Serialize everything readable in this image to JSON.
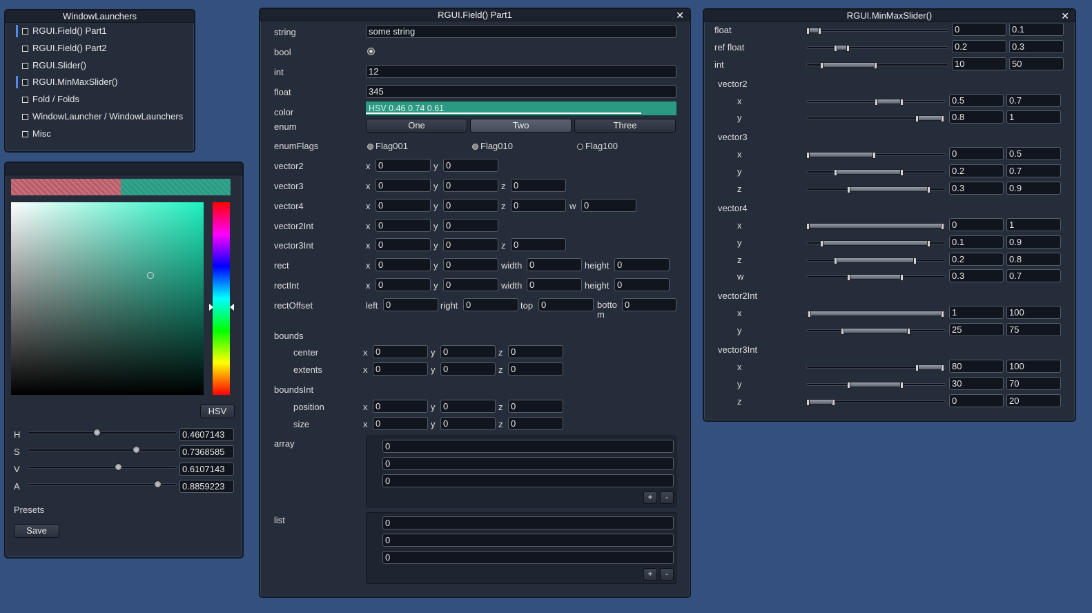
{
  "launchers": {
    "title": "WindowLaunchers",
    "items": [
      "RGUI.Field() Part1",
      "RGUI.Field() Part2",
      "RGUI.Slider()",
      "RGUI.MinMaxSlider()",
      "Fold / Folds",
      "WindowLauncher / WindowLaunchers",
      "Misc"
    ],
    "active_items": [
      0,
      3
    ]
  },
  "picker": {
    "mode_button": "HSV",
    "channels": [
      {
        "label": "H",
        "value": "0.4607143",
        "fraction": 0.4607143
      },
      {
        "label": "S",
        "value": "0.7368585",
        "fraction": 0.7368585
      },
      {
        "label": "V",
        "value": "0.6107143",
        "fraction": 0.6107143
      },
      {
        "label": "A",
        "value": "0.8859223",
        "fraction": 0.8859223
      }
    ],
    "presets_label": "Presets",
    "save_label": "Save",
    "old_color": "#b85b67",
    "new_color": "#2a9a83",
    "hue_color": "#1ef1c0"
  },
  "field": {
    "title": "RGUI.Field() Part1",
    "close": "✕",
    "string_label": "string",
    "string_value": "some string",
    "bool_label": "bool",
    "int_label": "int",
    "int_value": "12",
    "float_label": "float",
    "float_value": "345",
    "color_label": "color",
    "color_value": "HSV 0.46 0.74 0.61",
    "color_hex": "#2a9a83",
    "color_alpha": 0.8859,
    "enum_label": "enum",
    "enum_options": [
      "One",
      "Two",
      "Three"
    ],
    "enum_selected": 1,
    "enumflags_label": "enumFlags",
    "flags": [
      "Flag001",
      "Flag010",
      "Flag100"
    ],
    "axes": {
      "x": "x",
      "y": "y",
      "z": "z",
      "w": "w",
      "width": "width",
      "height": "height",
      "left": "left",
      "right": "right",
      "top": "top",
      "bottom": "botto\nm"
    },
    "vector2_label": "vector2",
    "vector3_label": "vector3",
    "vector4_label": "vector4",
    "vector2int_label": "vector2Int",
    "vector3int_label": "vector3Int",
    "rect_label": "rect",
    "rectint_label": "rectInt",
    "rectoffset_label": "rectOffset",
    "bounds_label": "bounds",
    "center_label": "center",
    "extents_label": "extents",
    "boundsint_label": "boundsInt",
    "position_label": "position",
    "size_label": "size",
    "zero": "0",
    "array_label": "array",
    "array_values": [
      "0",
      "0",
      "0"
    ],
    "list_label": "list",
    "list_values": [
      "0",
      "0",
      "0"
    ],
    "plus": "+",
    "minus": "-"
  },
  "minmax": {
    "title": "RGUI.MinMaxSlider()",
    "close": "✕",
    "rows": [
      {
        "label": "float",
        "indent": 0,
        "min": "0",
        "max": "0.1",
        "lo": 0,
        "hi": 0.1
      },
      {
        "label": "ref float",
        "indent": 0,
        "min": "0.2",
        "max": "0.3",
        "lo": 0.2,
        "hi": 0.3
      },
      {
        "label": "int",
        "indent": 0,
        "min": "10",
        "max": "50",
        "lo": 0.1,
        "hi": 0.5
      },
      {
        "label": "vector2",
        "header": true
      },
      {
        "label": "x",
        "indent": 1,
        "min": "0.5",
        "max": "0.7",
        "lo": 0.5,
        "hi": 0.7
      },
      {
        "label": "y",
        "indent": 1,
        "min": "0.8",
        "max": "1",
        "lo": 0.8,
        "hi": 1
      },
      {
        "label": "vector3",
        "header": true
      },
      {
        "label": "x",
        "indent": 1,
        "min": "0",
        "max": "0.5",
        "lo": 0,
        "hi": 0.5
      },
      {
        "label": "y",
        "indent": 1,
        "min": "0.2",
        "max": "0.7",
        "lo": 0.2,
        "hi": 0.7
      },
      {
        "label": "z",
        "indent": 1,
        "min": "0.3",
        "max": "0.9",
        "lo": 0.3,
        "hi": 0.9
      },
      {
        "label": "vector4",
        "header": true
      },
      {
        "label": "x",
        "indent": 1,
        "min": "0",
        "max": "1",
        "lo": 0,
        "hi": 1
      },
      {
        "label": "y",
        "indent": 1,
        "min": "0.1",
        "max": "0.9",
        "lo": 0.1,
        "hi": 0.9
      },
      {
        "label": "z",
        "indent": 1,
        "min": "0.2",
        "max": "0.8",
        "lo": 0.2,
        "hi": 0.8
      },
      {
        "label": "w",
        "indent": 1,
        "min": "0.3",
        "max": "0.7",
        "lo": 0.3,
        "hi": 0.7
      },
      {
        "label": "vector2Int",
        "header": true
      },
      {
        "label": "x",
        "indent": 1,
        "min": "1",
        "max": "100",
        "lo": 0.01,
        "hi": 1
      },
      {
        "label": "y",
        "indent": 1,
        "min": "25",
        "max": "75",
        "lo": 0.25,
        "hi": 0.75
      },
      {
        "label": "vector3Int",
        "header": true
      },
      {
        "label": "x",
        "indent": 1,
        "min": "80",
        "max": "100",
        "lo": 0.8,
        "hi": 1
      },
      {
        "label": "y",
        "indent": 1,
        "min": "30",
        "max": "70",
        "lo": 0.3,
        "hi": 0.7
      },
      {
        "label": "z",
        "indent": 1,
        "min": "0",
        "max": "20",
        "lo": 0,
        "hi": 0.2
      }
    ]
  }
}
